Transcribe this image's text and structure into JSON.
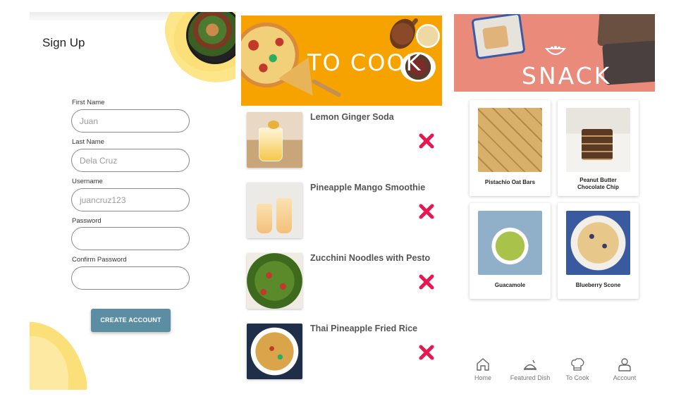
{
  "signup": {
    "title": "Sign Up",
    "fields": [
      {
        "label": "First Name",
        "value": "",
        "placeholder": "Juan"
      },
      {
        "label": "Last Name",
        "value": "",
        "placeholder": "Dela Cruz"
      },
      {
        "label": "Username",
        "value": "",
        "placeholder": "juancruz123"
      },
      {
        "label": "Password",
        "value": "",
        "placeholder": ""
      },
      {
        "label": "Confirm Password",
        "value": "",
        "placeholder": ""
      }
    ],
    "create_label": "CREATE ACCOUNT"
  },
  "tocook": {
    "banner_text": "TO COOK",
    "items": [
      {
        "title": "Lemon Ginger Soda",
        "remove_icon": "close-icon"
      },
      {
        "title": "Pineapple Mango Smoothie",
        "remove_icon": "close-icon"
      },
      {
        "title": "Zucchini Noodles with Pesto",
        "remove_icon": "close-icon"
      },
      {
        "title": "Thai Pineapple Fried Rice",
        "remove_icon": "close-icon"
      }
    ]
  },
  "snack": {
    "banner_text": "SNACK",
    "cards": [
      {
        "label": "Pistachio Oat Bars"
      },
      {
        "label_line1": "Peanut Butter",
        "label_line2": "Chocolate Chip"
      },
      {
        "label": "Guacamole"
      },
      {
        "label": "Blueberry Scone"
      }
    ],
    "nav": [
      {
        "label": "Home",
        "icon": "home-icon"
      },
      {
        "label": "Featured Dish",
        "icon": "featured-dish-icon"
      },
      {
        "label": "To Cook",
        "icon": "chef-hat-icon"
      },
      {
        "label": "Account",
        "icon": "account-icon"
      }
    ]
  },
  "colors": {
    "button": "#5b8ea3",
    "tocook_banner": "#f6a300",
    "snack_banner": "#e98a7a",
    "remove_x": "#e8184f",
    "accent_yellow": "#fbe07a"
  }
}
